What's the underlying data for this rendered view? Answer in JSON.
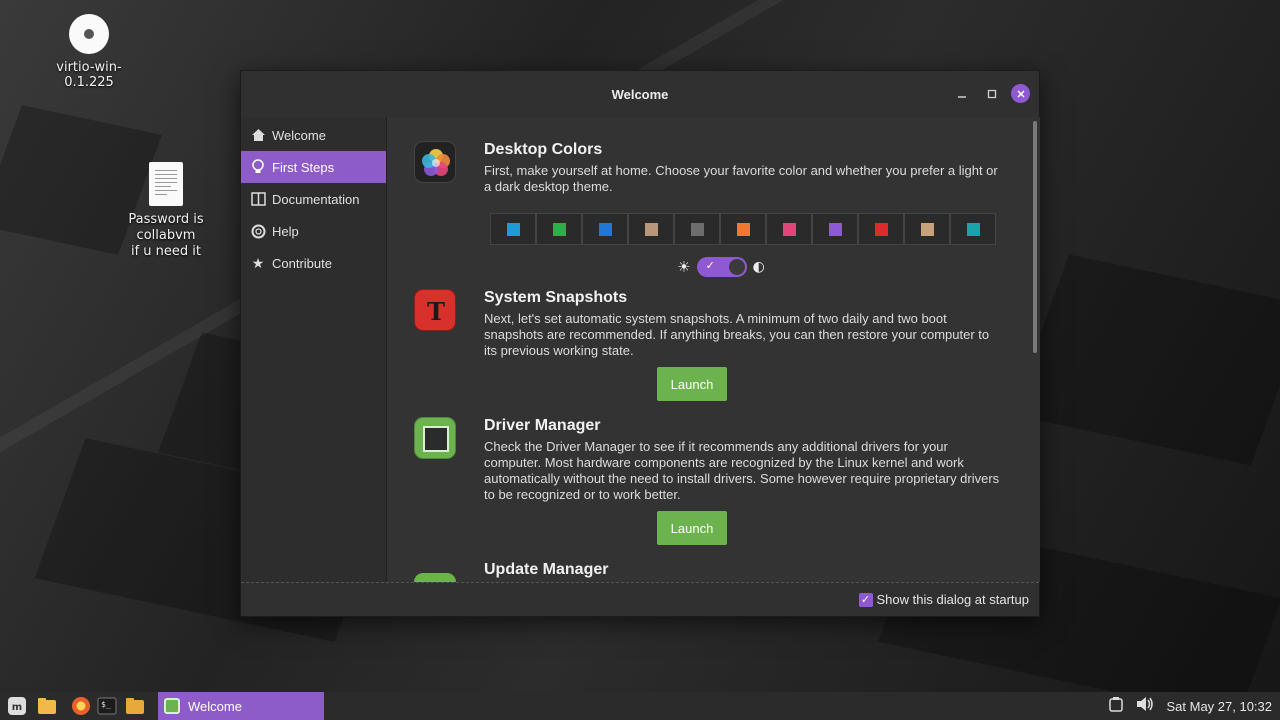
{
  "desktop": {
    "icons": [
      {
        "label": "virtio-win-0.1.225"
      },
      {
        "label_line1": "Password is collabvm",
        "label_line2": "if u need it"
      }
    ]
  },
  "window": {
    "title": "Welcome",
    "controls": {
      "minimize": "–",
      "maximize": "□",
      "close": "×"
    }
  },
  "sidebar": {
    "items": [
      {
        "label": "Welcome",
        "icon": "home-icon"
      },
      {
        "label": "First Steps",
        "icon": "lightbulb-icon",
        "active": true
      },
      {
        "label": "Documentation",
        "icon": "book-icon"
      },
      {
        "label": "Help",
        "icon": "lifebuoy-icon"
      },
      {
        "label": "Contribute",
        "icon": "star-icon"
      }
    ]
  },
  "sections": {
    "desktop_colors": {
      "title": "Desktop Colors",
      "text": "First, make yourself at home. Choose your favorite color and whether you prefer a light or a dark desktop theme.",
      "swatches": [
        "#1e9ad6",
        "#2cae4b",
        "#1f78d6",
        "#b8977a",
        "#6d6d6d",
        "#f2782f",
        "#e2457a",
        "#8c5ad8",
        "#dd2b2b",
        "#c8a27a",
        "#1aa3ac"
      ],
      "theme": "dark"
    },
    "snapshots": {
      "title": "System Snapshots",
      "text": "Next, let's set automatic system snapshots. A minimum of two daily and two boot snapshots are recommended. If anything breaks, you can then restore your computer to its previous working state.",
      "button": "Launch"
    },
    "drivers": {
      "title": "Driver Manager",
      "text": "Check the Driver Manager to see if it recommends any additional drivers for your computer. Most hardware components are recognized by the Linux kernel and work automatically without the need to install drivers. Some however require proprietary drivers to be recognized or to work better.",
      "button": "Launch"
    },
    "updates": {
      "title": "Update Manager"
    }
  },
  "footer": {
    "checkbox_label": "Show this dialog at startup",
    "checked": true
  },
  "taskbar": {
    "task_label": "Welcome",
    "clock": "Sat May 27, 10:32"
  },
  "colors": {
    "accent": "#8d5cc8",
    "launch_green": "#6cb34f"
  }
}
